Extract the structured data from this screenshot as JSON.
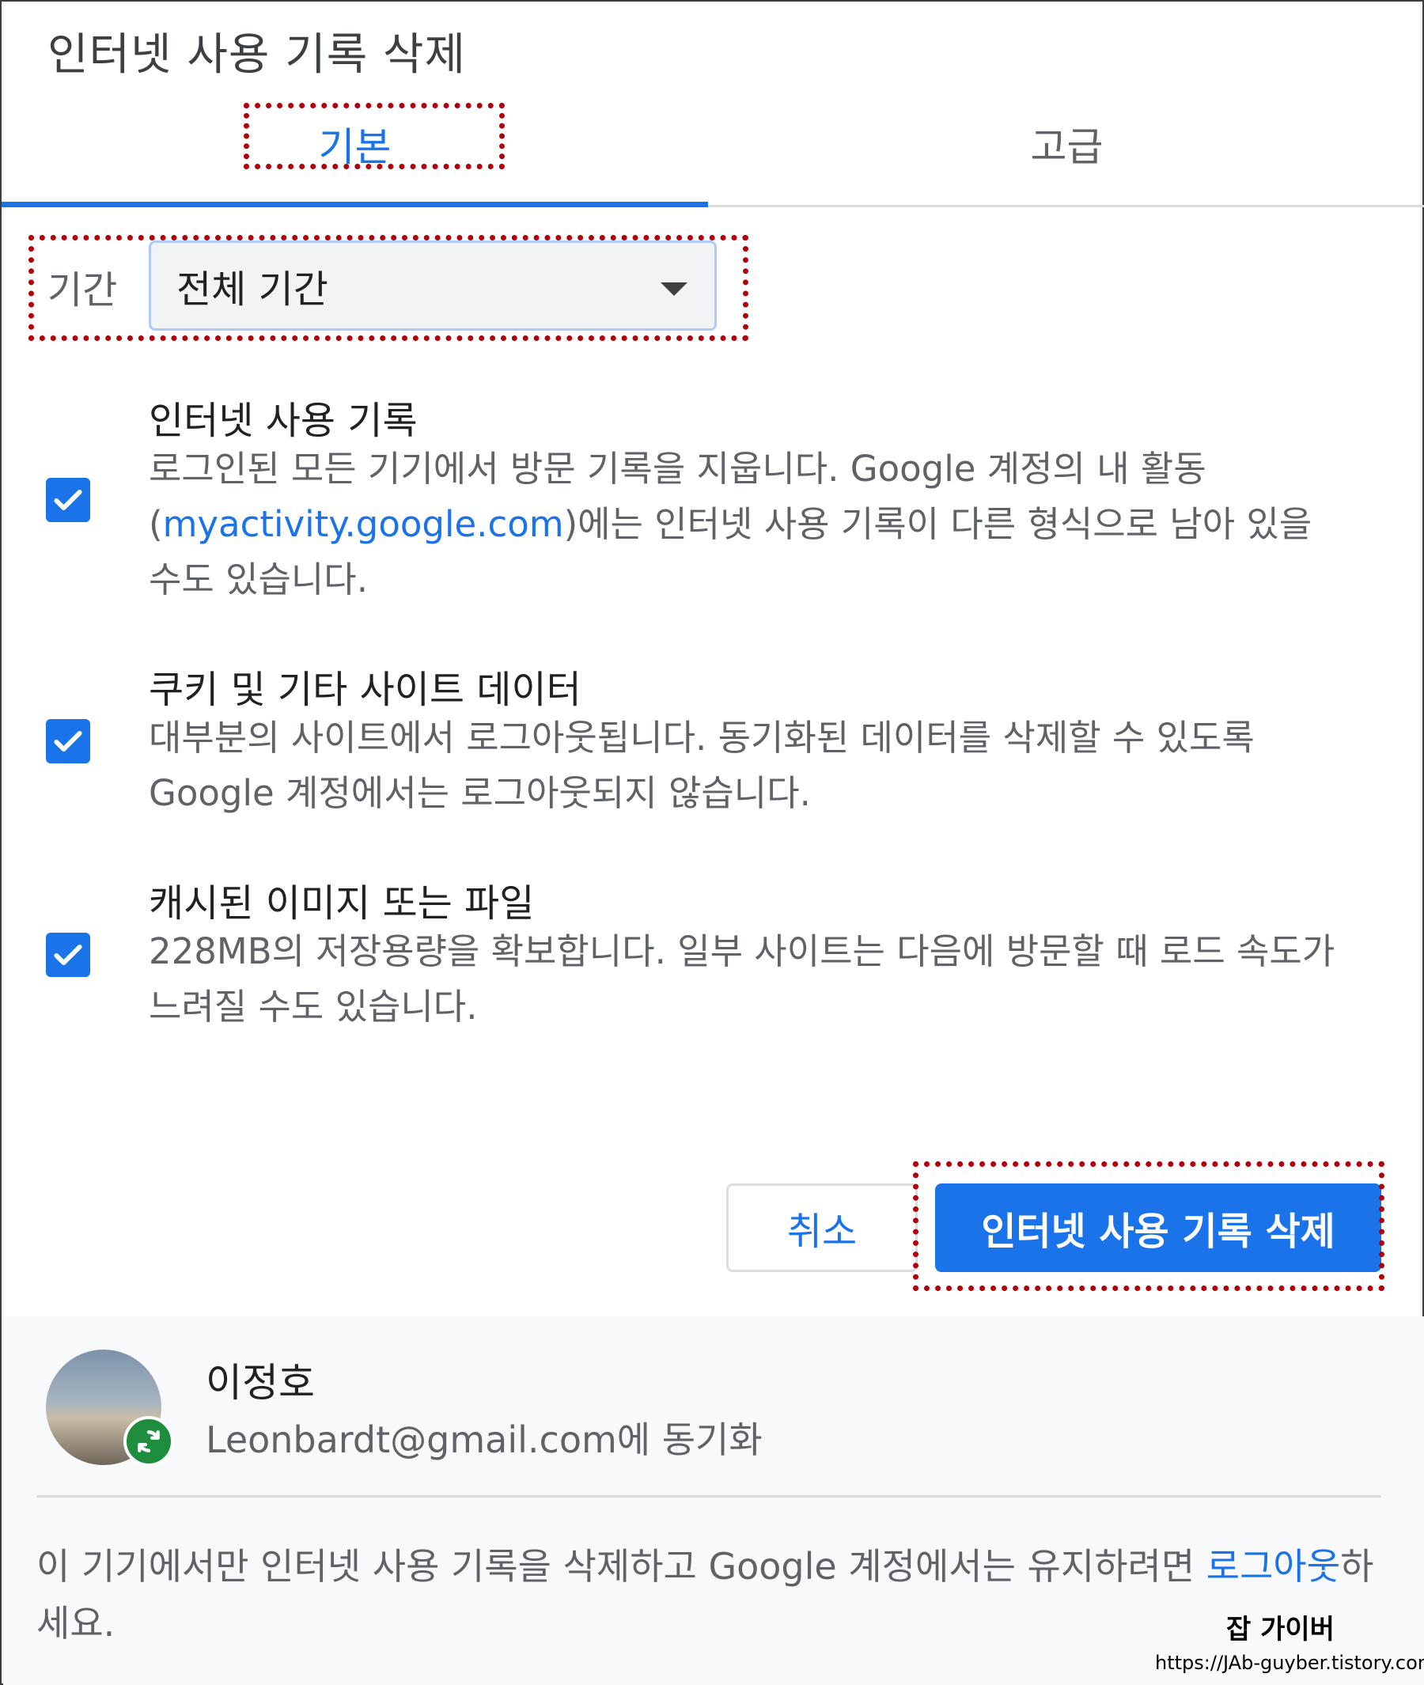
{
  "dialog": {
    "title": "인터넷 사용 기록 삭제"
  },
  "tabs": [
    {
      "label": "기본",
      "selected": true
    },
    {
      "label": "고급",
      "selected": false
    }
  ],
  "period": {
    "label": "기간",
    "selected": "전체 기간"
  },
  "options": [
    {
      "title": "인터넷 사용 기록",
      "desc_before": "로그인된 모든 기기에서 방문 기록을 지웁니다. Google 계정의 내 활동 (",
      "desc_link": "myactivity.google.com",
      "desc_after": ")에는 인터넷 사용 기록이 다른 형식으로 남아 있을 수도 있습니다.",
      "checked": true
    },
    {
      "title": "쿠키 및 기타 사이트 데이터",
      "desc": "대부분의 사이트에서 로그아웃됩니다. 동기화된 데이터를 삭제할 수 있도록 Google 계정에서는 로그아웃되지 않습니다.",
      "checked": true
    },
    {
      "title": "캐시된 이미지 또는 파일",
      "desc": "228MB의 저장용량을 확보합니다. 일부 사이트는 다음에 방문할 때 로드 속도가 느려질 수도 있습니다.",
      "checked": true
    }
  ],
  "buttons": {
    "cancel": "취소",
    "delete": "인터넷 사용 기록 삭제"
  },
  "account": {
    "name": "이정호",
    "sync_text": "Leonbardt@gmail.com에 동기화"
  },
  "footer": {
    "text_before": "이 기기에서만 인터넷 사용 기록을 삭제하고 Google 계정에서는 유지하려면 ",
    "link": "로그아웃",
    "text_after": "하세요."
  },
  "watermark": {
    "name": "잡 가이버",
    "url": "https://JAb-guyber.tistory.com"
  },
  "colors": {
    "accent": "#1a73e8",
    "highlight_box": "#b0000a",
    "sync_badge": "#1e8e3e"
  },
  "icons": {
    "checkbox": "checkmark-icon",
    "dropdown": "caret-down-icon",
    "sync": "sync-icon"
  }
}
